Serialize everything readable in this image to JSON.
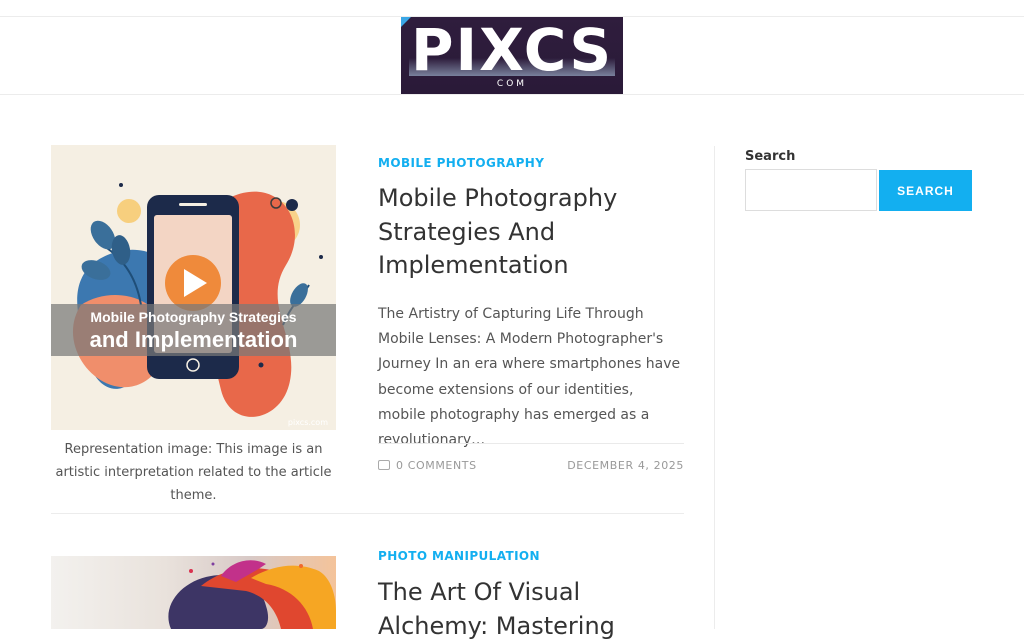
{
  "header": {
    "logo_text": "PIXCS",
    "logo_subtext": "COM"
  },
  "posts": [
    {
      "image_overlay_line1": "Mobile Photography Strategies",
      "image_overlay_line2": "and Implementation",
      "image_watermark": "pixcs.com",
      "caption": "Representation image: This image is an artistic interpretation related to the article theme.",
      "category": "MOBILE PHOTOGRAPHY",
      "title": "Mobile Photography Strategies And Implementation",
      "excerpt": "The Artistry of Capturing Life Through Mobile Lenses: A Modern Photographer's Journey In an era where smartphones have become extensions of our identities, mobile photography has emerged as a revolutionary…",
      "comments": "0 COMMENTS",
      "date": "DECEMBER 4, 2025"
    },
    {
      "category": "PHOTO MANIPULATION",
      "title": "The Art Of Visual Alchemy: Mastering"
    }
  ],
  "sidebar": {
    "search_label": "Search",
    "search_value": "",
    "search_button": "SEARCH"
  },
  "colors": {
    "accent": "#13aff0",
    "logo_bg": "#2f1d3d",
    "text": "#333333"
  }
}
